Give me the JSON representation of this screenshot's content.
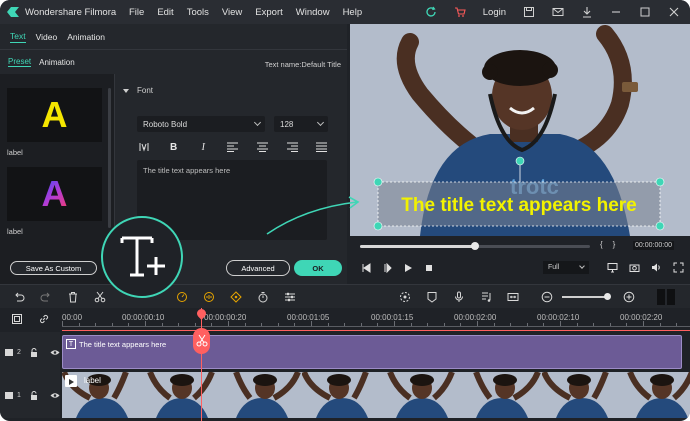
{
  "app": {
    "title": "Wondershare Filmora",
    "menu": [
      "File",
      "Edit",
      "Tools",
      "View",
      "Export",
      "Window",
      "Help"
    ],
    "login_label": "Login",
    "accent_color": "#3fd6b6"
  },
  "editor": {
    "main_tabs": [
      "Text",
      "Video",
      "Animation"
    ],
    "sub_tabs": [
      "Preset",
      "Animation"
    ],
    "text_name": "Text name:Default Title",
    "presets": [
      {
        "glyph": "A",
        "label": "label"
      },
      {
        "glyph": "A",
        "label": "label"
      }
    ],
    "font_section_label": "Font",
    "font_family_value": "Roboto Bold",
    "font_size_value": "128",
    "format_icons": [
      "letter-spacing-icon",
      "bold-icon",
      "italic-icon",
      "align-left-icon",
      "align-center-icon",
      "align-right-icon",
      "justify-icon"
    ],
    "bold_label": "B",
    "italic_label": "I",
    "text_content": "The title text appears here",
    "save_custom_label": "Save As Custom",
    "advanced_label": "Advanced",
    "ok_label": "OK"
  },
  "preview": {
    "title_overlay": "The title text appears here",
    "title_color": "#f2f200",
    "shirt_brand": "trotc",
    "playback_progress": 0.5,
    "timecode": "00:00:00:00",
    "mark_in_label": "{",
    "mark_out_label": "}",
    "zoom_value": "Full"
  },
  "timeline": {
    "ruler_labels": [
      "00:00",
      "00:00:00:10",
      "00:00:00:20",
      "00:00:01:05",
      "00:00:01:15",
      "00:00:02:00",
      "00:00:02:10",
      "00:00:02:20"
    ],
    "tracks": [
      {
        "index_label": "2",
        "clip_label": "The title text appears here"
      },
      {
        "index_label": "1",
        "clip_label": "label"
      }
    ],
    "playhead_time_fraction": 0.22
  }
}
